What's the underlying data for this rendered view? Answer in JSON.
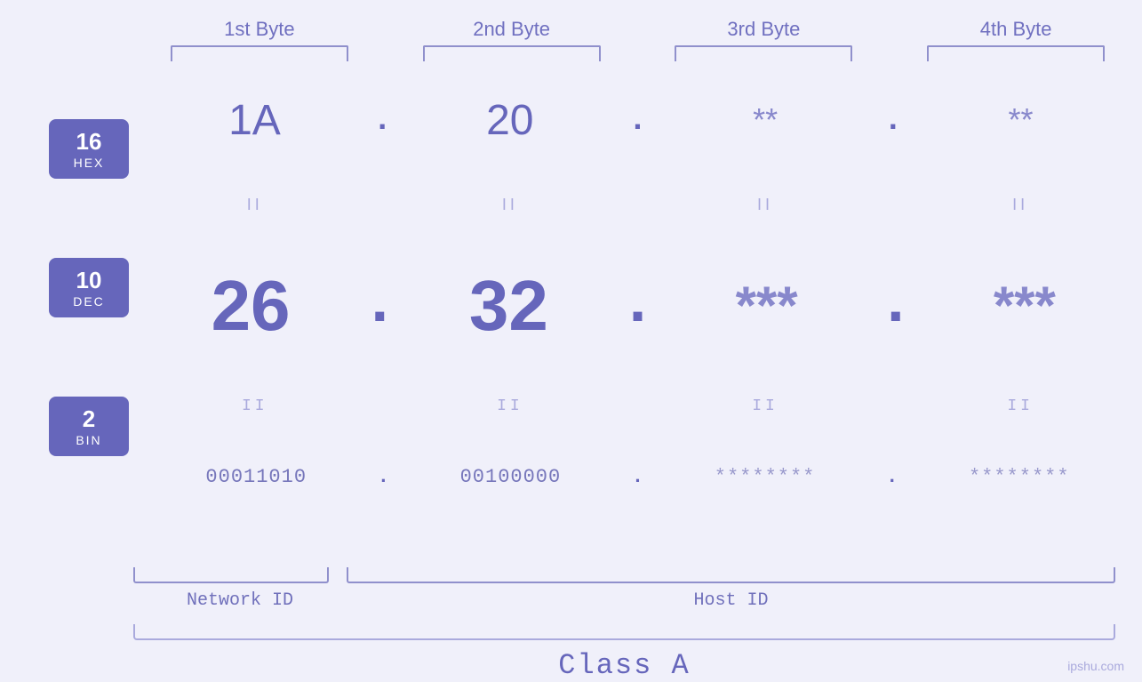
{
  "header": {
    "byte1": "1st Byte",
    "byte2": "2nd Byte",
    "byte3": "3rd Byte",
    "byte4": "4th Byte"
  },
  "bases": {
    "hex": {
      "number": "16",
      "name": "HEX"
    },
    "dec": {
      "number": "10",
      "name": "DEC"
    },
    "bin": {
      "number": "2",
      "name": "BIN"
    }
  },
  "rows": {
    "hex": {
      "b1": "1A",
      "b2": "20",
      "b3": "**",
      "b4": "**",
      "dot": "."
    },
    "dec": {
      "b1": "26",
      "b2": "32",
      "b3": "***",
      "b4": "***",
      "dot": "."
    },
    "bin": {
      "b1": "00011010",
      "b2": "00100000",
      "b3": "********",
      "b4": "********",
      "dot": "."
    }
  },
  "labels": {
    "network_id": "Network ID",
    "host_id": "Host ID",
    "class": "Class A"
  },
  "footer": {
    "text": "ipshu.com"
  },
  "colors": {
    "accent": "#6666bb",
    "light_accent": "#aaaadd",
    "bg": "#f0f0fa"
  }
}
